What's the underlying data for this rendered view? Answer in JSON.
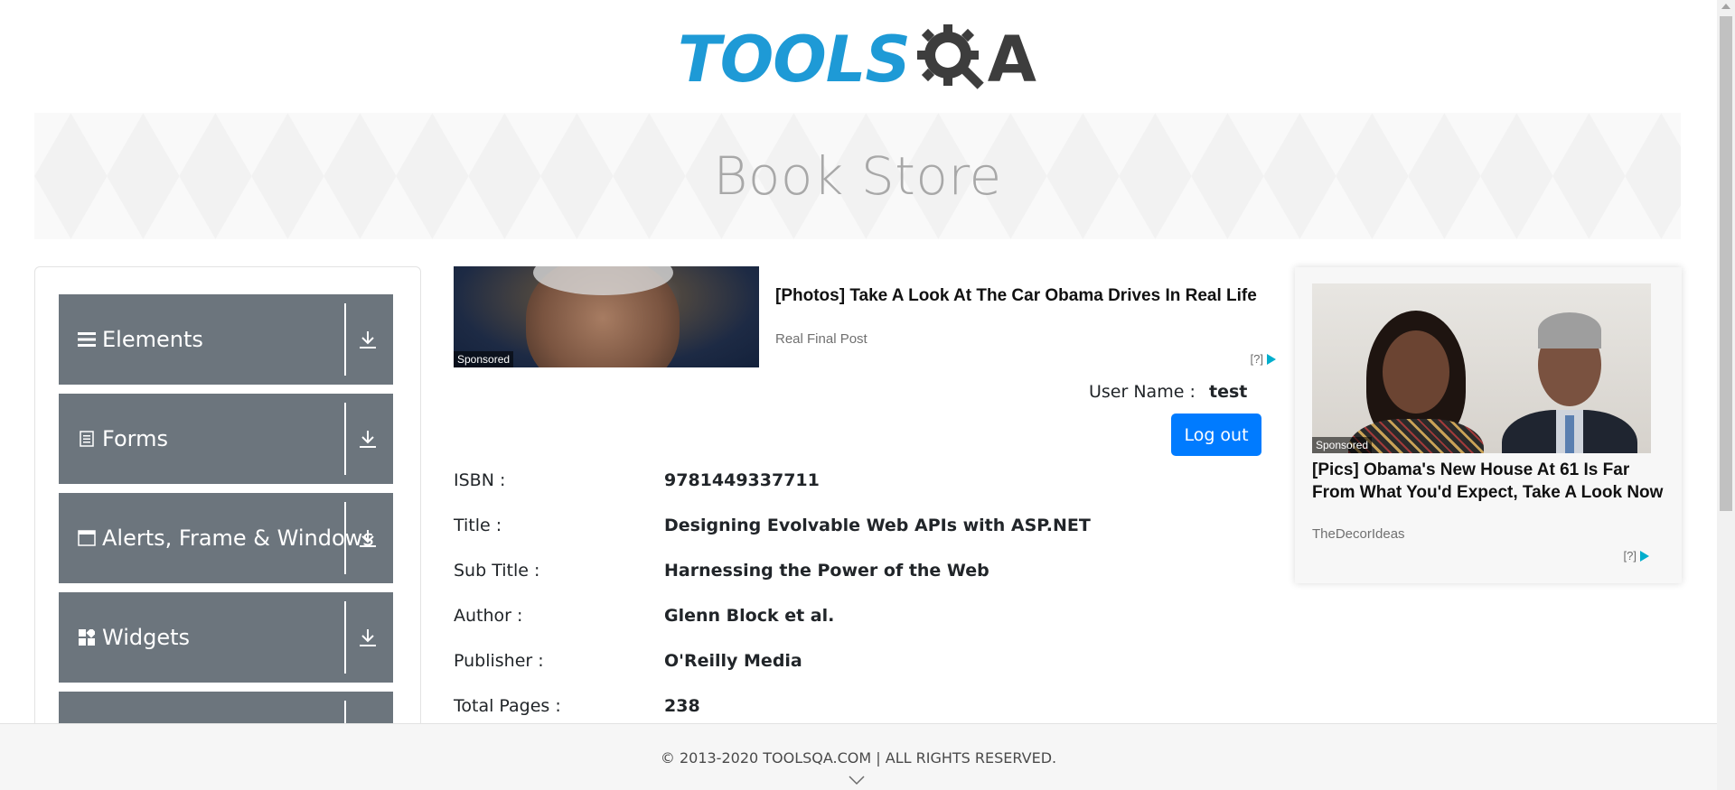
{
  "header": {
    "logo_text_left": "TOOLS",
    "logo_text_right": "QA",
    "banner_title": "Book Store"
  },
  "sidebar": {
    "items": [
      {
        "label": "Elements",
        "icon": "list-icon"
      },
      {
        "label": "Forms",
        "icon": "document-icon"
      },
      {
        "label": "Alerts, Frame & Windows",
        "icon": "window-icon"
      },
      {
        "label": "Widgets",
        "icon": "widgets-icon"
      },
      {
        "label": "",
        "icon": ""
      }
    ]
  },
  "ads": {
    "top": {
      "title": "[Photos] Take A Look At The Car Obama Drives In Real Life",
      "source": "Real Final Post",
      "sponsored": "Sponsored",
      "choice": "[?]"
    },
    "right": {
      "title": "[Pics] Obama's New House At 61 Is Far From What You'd Expect, Take A Look Now",
      "source": "TheDecorIdeas",
      "sponsored": "Sponsored",
      "choice": "[?]"
    }
  },
  "user": {
    "label": "User Name :",
    "value": "test",
    "logout_label": "Log out"
  },
  "book": {
    "fields": [
      {
        "label": "ISBN :",
        "value": "9781449337711"
      },
      {
        "label": "Title :",
        "value": "Designing Evolvable Web APIs with ASP.NET"
      },
      {
        "label": "Sub Title :",
        "value": "Harnessing the Power of the Web"
      },
      {
        "label": "Author :",
        "value": "Glenn Block et al."
      },
      {
        "label": "Publisher :",
        "value": "O'Reilly Media"
      },
      {
        "label": "Total Pages :",
        "value": "238"
      }
    ]
  },
  "footer": {
    "copyright": "© 2013-2020 TOOLSQA.COM | ALL RIGHTS RESERVED."
  },
  "colors": {
    "brand_blue": "#1e9ad6",
    "menu_gray": "#6c757d",
    "button_blue": "#007bff"
  }
}
